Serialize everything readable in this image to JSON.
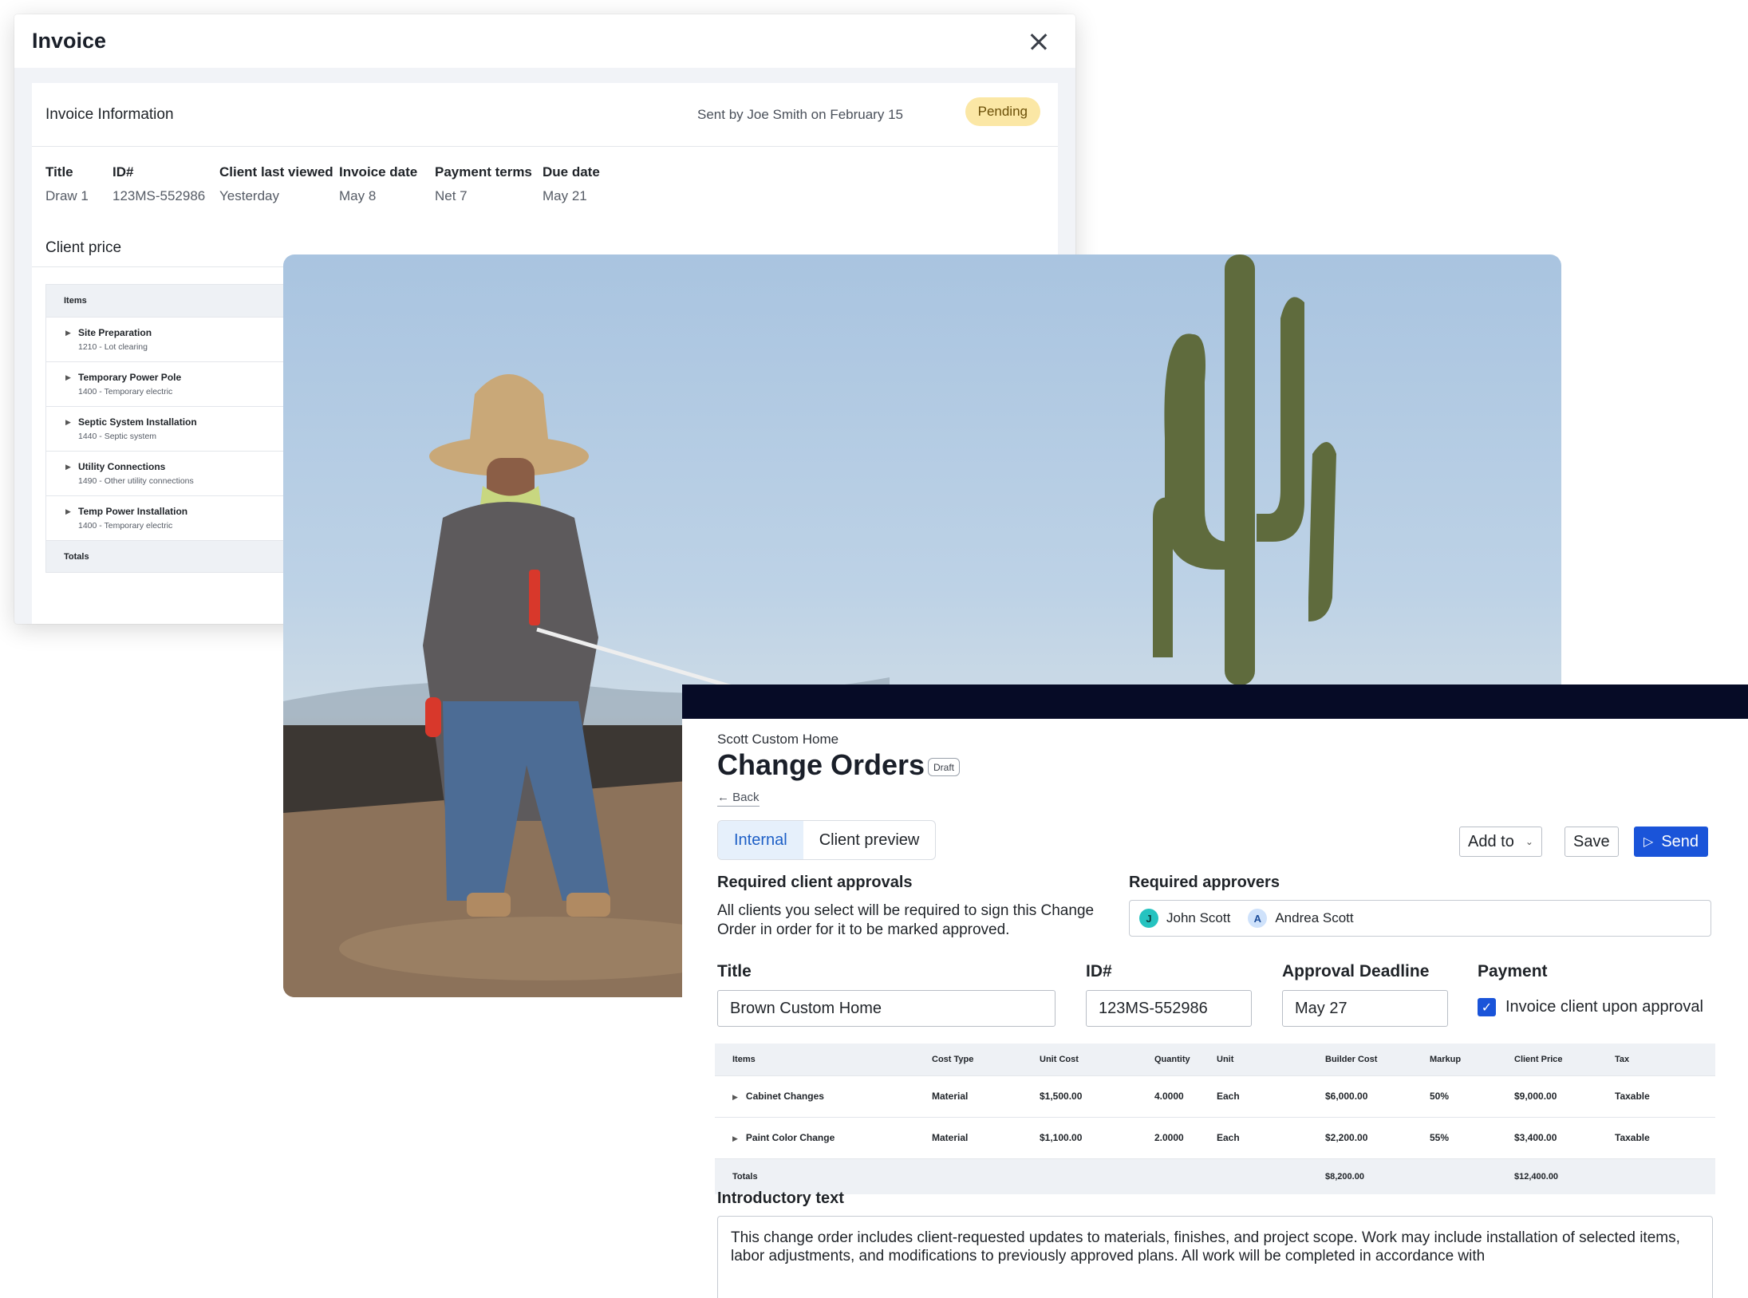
{
  "invoice": {
    "window_title": "Invoice",
    "info_heading": "Invoice Information",
    "sent_by": "Sent by Joe Smith on February 15",
    "status": "Pending",
    "fields": [
      {
        "label": "Title",
        "value": "Draw 1"
      },
      {
        "label": "ID#",
        "value": "123MS-552986"
      },
      {
        "label": "Client last viewed",
        "value": "Yesterday"
      },
      {
        "label": "Invoice date",
        "value": "May 8"
      },
      {
        "label": "Payment terms",
        "value": "Net 7"
      },
      {
        "label": "Due date",
        "value": "May 21"
      }
    ],
    "client_price_heading": "Client price",
    "table": {
      "header": "Items",
      "rows": [
        {
          "name": "Site Preparation",
          "code": "1210 - Lot clearing"
        },
        {
          "name": "Temporary Power Pole",
          "code": "1400 - Temporary electric"
        },
        {
          "name": "Septic System Installation",
          "code": "1440 - Septic system"
        },
        {
          "name": "Utility Connections",
          "code": "1490 - Other utility connections"
        },
        {
          "name": "Temp Power Installation",
          "code": "1400 - Temporary electric"
        }
      ],
      "totals_label": "Totals"
    }
  },
  "change_orders": {
    "project": "Scott Custom Home",
    "title": "Change Orders",
    "badge": "Draft",
    "back": "Back",
    "tabs": [
      {
        "label": "Internal",
        "active": true
      },
      {
        "label": "Client preview",
        "active": false
      }
    ],
    "buttons": {
      "add_to": "Add to",
      "save": "Save",
      "send": "Send"
    },
    "required_client_approvals": {
      "heading": "Required client approvals",
      "text": "All clients you select will be required to sign this Change Order in order for it to be marked approved."
    },
    "required_approvers": {
      "heading": "Required approvers",
      "people": [
        {
          "initial": "J",
          "name": "John Scott"
        },
        {
          "initial": "A",
          "name": "Andrea Scott"
        }
      ]
    },
    "form": {
      "title_label": "Title",
      "title_value": "Brown Custom Home",
      "id_label": "ID#",
      "id_value": "123MS-552986",
      "deadline_label": "Approval Deadline",
      "deadline_value": "May 27",
      "payment_label": "Payment",
      "payment_checkbox": "Invoice client upon approval"
    },
    "table": {
      "columns": [
        "Items",
        "Cost Type",
        "Unit Cost",
        "Quantity",
        "Unit",
        "Builder Cost",
        "Markup",
        "Client Price",
        "Tax"
      ],
      "rows": [
        [
          "Cabinet Changes",
          "Material",
          "$1,500.00",
          "4.0000",
          "Each",
          "$6,000.00",
          "50%",
          "$9,000.00",
          "Taxable"
        ],
        [
          "Paint Color Change",
          "Material",
          "$1,100.00",
          "2.0000",
          "Each",
          "$2,200.00",
          "55%",
          "$3,400.00",
          "Taxable"
        ]
      ],
      "totals": {
        "label": "Totals",
        "builder_cost": "$8,200.00",
        "client_price": "$12,400.00"
      }
    },
    "intro": {
      "heading": "Introductory text",
      "text": "This change order includes client-requested updates to materials, finishes, and project scope. Work may include installation of selected items, labor adjustments, and modifications to previously approved plans. All work will be completed in accordance with"
    }
  },
  "colors": {
    "primary": "#1a54d9",
    "navy_bar": "#060b26",
    "pending_bg": "#fbe7a5",
    "tab_active_bg": "#e6f0fb"
  }
}
